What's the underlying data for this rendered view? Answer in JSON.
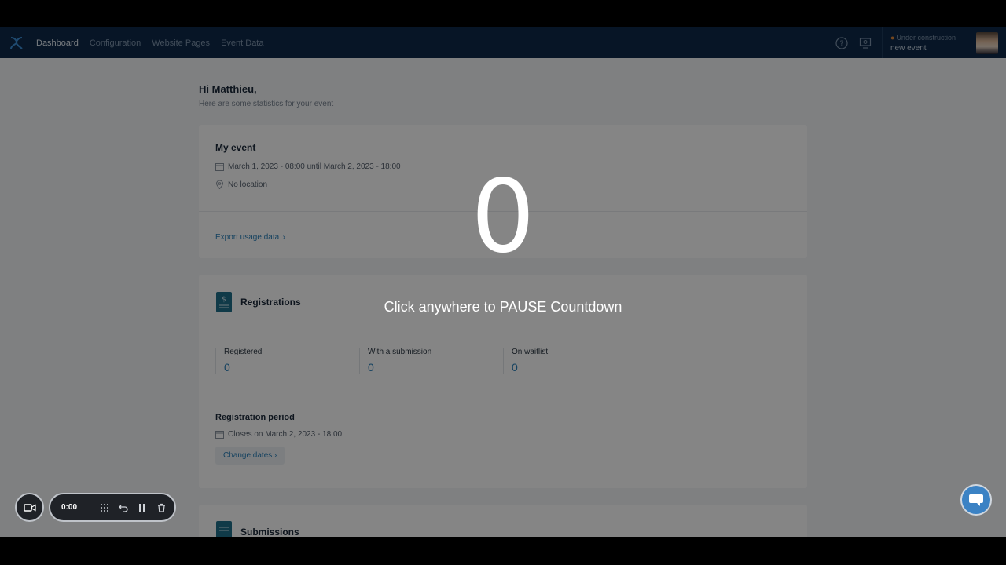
{
  "nav": {
    "items": [
      "Dashboard",
      "Configuration",
      "Website Pages",
      "Event Data"
    ],
    "event_status": "Under construction",
    "event_name": "new event"
  },
  "greeting": {
    "title": "Hi Matthieu,",
    "subtitle": "Here are some statistics for your event"
  },
  "event_card": {
    "title": "My event",
    "dates": "March 1, 2023 - 08:00 until March 2, 2023 - 18:00",
    "location": "No location",
    "export_link": "Export usage data"
  },
  "registrations": {
    "title": "Registrations",
    "stats": [
      {
        "label": "Registered",
        "value": "0"
      },
      {
        "label": "With a submission",
        "value": "0"
      },
      {
        "label": "On waitlist",
        "value": "0"
      }
    ],
    "period_title": "Registration period",
    "period_closes": "Closes on March 2, 2023 - 18:00",
    "change_dates": "Change dates"
  },
  "submissions": {
    "title": "Submissions"
  },
  "overlay": {
    "count": "0",
    "message": "Click anywhere to PAUSE Countdown"
  },
  "recorder": {
    "time": "0:00"
  },
  "colors": {
    "nav_bg": "#0e2a4a",
    "accent": "#2a7fb8",
    "status_dot": "#e0893b"
  }
}
